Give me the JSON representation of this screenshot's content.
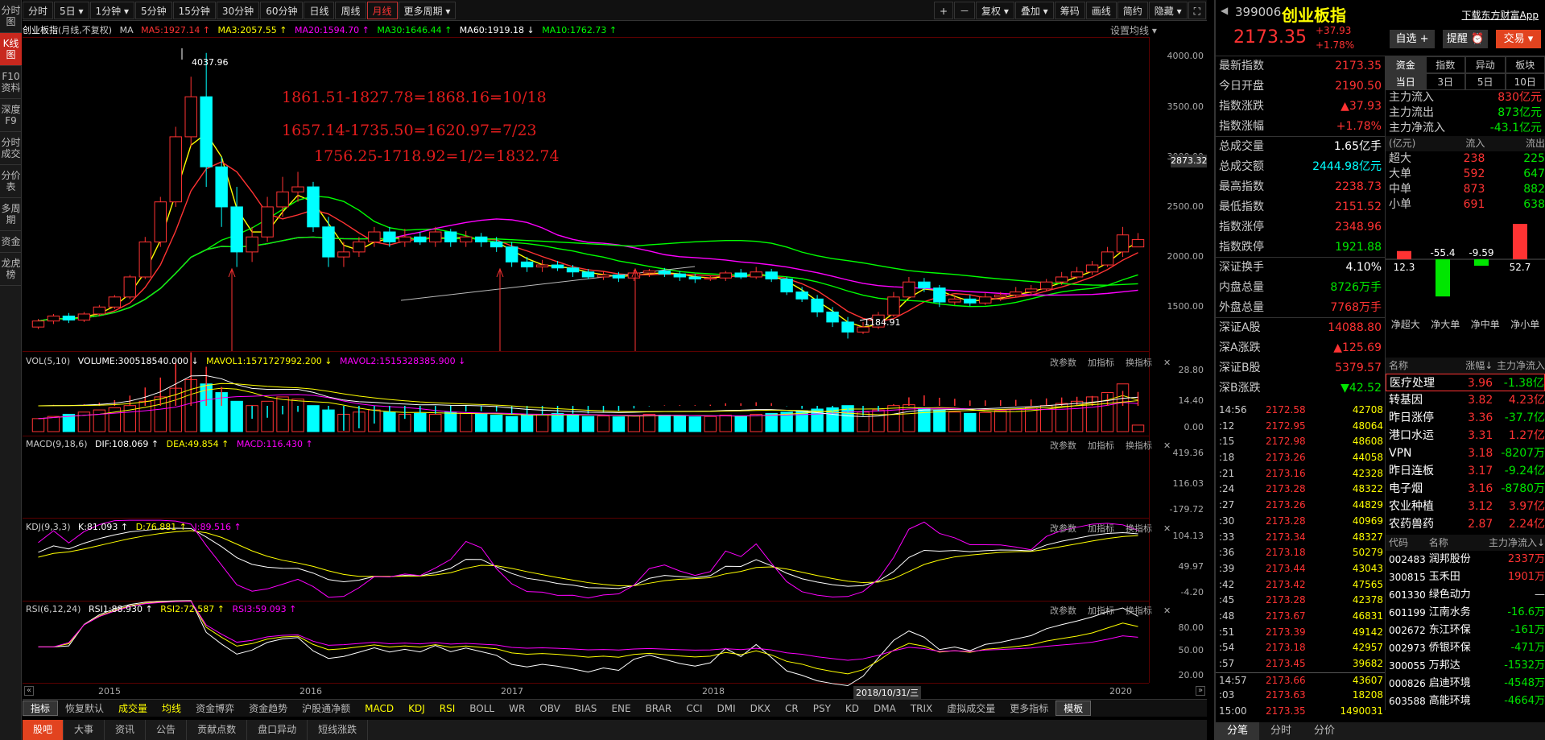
{
  "left_sidebar": [
    "分时图",
    "K线图",
    "F10资料",
    "深度F9",
    "分时成交",
    "分价表",
    "多周期",
    "资金",
    "龙虎榜"
  ],
  "toolbar": {
    "periods": [
      "分时",
      "5日 ▾",
      "1分钟 ▾",
      "5分钟",
      "15分钟",
      "30分钟",
      "60分钟",
      "日线",
      "周线",
      "月线",
      "更多周期 ▾"
    ],
    "active_period": "月线",
    "right": [
      "+",
      "－",
      "复权 ▾",
      "叠加 ▾",
      "筹码",
      "画线",
      "简约",
      "隐藏 ▾",
      "⛶"
    ]
  },
  "info_bar": {
    "name": "创业板指",
    "mode": "(月线,不复权)",
    "ma": "MA",
    "ma5": "MA5:1927.14 ↑",
    "ma3": "MA3:2057.55 ↑",
    "ma20": "MA20:1594.70 ↑",
    "ma30": "MA30:1646.44 ↑",
    "ma60": "MA60:1919.18 ↓",
    "ma10": "MA10:1762.73 ↑",
    "settings": "设置均线 ▾"
  },
  "annotations": [
    "1861.51-1827.78=1868.16=10/18",
    "1657.14-1735.50=1620.97=7/23",
    "1756.25-1718.92=1/2=1832.74"
  ],
  "main_axis": [
    "4000.00",
    "3500.00",
    "3000.00",
    "2500.00",
    "2000.00",
    "1500.00"
  ],
  "price_tag": "2873.32",
  "peak_label": "4037.96",
  "low_label": "1184.91",
  "vol": {
    "title": "VOL(5,10)",
    "volume": "VOLUME:300518540.000 ↓",
    "mavol1": "MAVOL1:1571727992.200 ↓",
    "mavol2": "MAVOL2:1515328385.900 ↓",
    "axis": [
      "28.80",
      "14.40",
      "0.00"
    ]
  },
  "macd": {
    "title": "MACD(9,18,6)",
    "dif": "DIF:108.069 ↑",
    "dea": "DEA:49.854 ↑",
    "macd": "MACD:116.430 ↑",
    "axis": [
      "419.36",
      "116.03",
      "-179.72"
    ]
  },
  "kdj": {
    "title": "KDJ(9,3,3)",
    "k": "K:81.093 ↑",
    "d": "D:76.881 ↑",
    "j": "J:89.516 ↑",
    "axis": [
      "104.13",
      "49.97",
      "-4.20"
    ]
  },
  "rsi": {
    "title": "RSI(6,12,24)",
    "r1": "RSI1:88.930 ↑",
    "r2": "RSI2:72.587 ↑",
    "r3": "RSI3:59.093 ↑",
    "axis": [
      "80.00",
      "50.00",
      "20.00"
    ]
  },
  "pane_buttons": [
    "改参数",
    "加指标",
    "换指标",
    "✕"
  ],
  "x_axis": [
    "2015",
    "2016",
    "2017",
    "2018",
    "2020"
  ],
  "x_cursor": "2018/10/31/三",
  "indicator_tabs": [
    "指标",
    "恢复默认",
    "成交量",
    "均线",
    "资金博弈",
    "资金趋势",
    "沪股通净额",
    "MACD",
    "KDJ",
    "RSI",
    "BOLL",
    "WR",
    "OBV",
    "BIAS",
    "ENE",
    "BRAR",
    "CCI",
    "DMI",
    "DKX",
    "CR",
    "PSY",
    "KD",
    "DMA",
    "TRIX",
    "虚拟成交量",
    "更多指标",
    "模板"
  ],
  "bottom_tabs": [
    "股吧",
    "大事",
    "资讯",
    "公告",
    "贡献点数",
    "盘口异动",
    "短线涨跌"
  ],
  "right_panel": {
    "code": "399006",
    "name": "创业板指",
    "download": "下载东方财富App",
    "price": "2173.35",
    "change": "+37.93",
    "pct": "+1.78%",
    "buttons": [
      "自选 +",
      "提醒 ⏰",
      "交易 ▾"
    ],
    "stats": [
      [
        "最新指数",
        "2173.35",
        "red"
      ],
      [
        "今日开盘",
        "2190.50",
        "red"
      ],
      [
        "指数涨跌",
        "▲37.93",
        "red"
      ],
      [
        "指数涨幅",
        "+1.78%",
        "red"
      ],
      [
        "总成交量",
        "1.65亿手",
        "wt"
      ],
      [
        "总成交额",
        "2444.98亿元",
        "cy"
      ],
      [
        "最高指数",
        "2238.73",
        "red"
      ],
      [
        "最低指数",
        "2151.52",
        "red"
      ],
      [
        "指数涨停",
        "2348.96",
        "red"
      ],
      [
        "指数跌停",
        "1921.88",
        "grn"
      ],
      [
        "深证换手",
        "4.10%",
        "wt"
      ],
      [
        "内盘总量",
        "8726万手",
        "grn"
      ],
      [
        "外盘总量",
        "7768万手",
        "red"
      ],
      [
        "深证A股",
        "14088.80",
        "red"
      ],
      [
        "深A涨跌",
        "▲125.69",
        "red"
      ],
      [
        "深证B股",
        "5379.57",
        "red"
      ],
      [
        "深B涨跌",
        "▼42.52",
        "grn"
      ]
    ],
    "fund_tabs1": [
      "资金",
      "指数",
      "异动",
      "板块"
    ],
    "fund_tabs2": [
      "当日",
      "3日",
      "5日",
      "10日"
    ],
    "flow": [
      [
        "主力流入",
        "830亿元",
        "red"
      ],
      [
        "主力流出",
        "873亿元",
        "grn"
      ],
      [
        "主力净流入",
        "-43.1亿元",
        "grn"
      ]
    ],
    "flow_hdr": [
      "(亿元)",
      "流入",
      "流出"
    ],
    "flow_rows": [
      [
        "超大",
        "238",
        "225"
      ],
      [
        "大单",
        "592",
        "647"
      ],
      [
        "中单",
        "873",
        "882"
      ],
      [
        "小单",
        "691",
        "638"
      ]
    ],
    "bars": [
      {
        "label": "12.3",
        "value": 12.3
      },
      {
        "label": "-55.4",
        "value": -55.4
      },
      {
        "label": "-9.59",
        "value": -9.59
      },
      {
        "label": "52.7",
        "value": 52.7
      }
    ],
    "bar_names": [
      "净超大",
      "净大单",
      "净中单",
      "净小单"
    ],
    "sector_hdr": [
      "名称",
      "涨幅↓",
      "主力净流入"
    ],
    "sectors": [
      [
        "医疗处理",
        "3.96",
        "-1.38亿"
      ],
      [
        "转基因",
        "3.82",
        "4.23亿"
      ],
      [
        "昨日涨停",
        "3.36",
        "-37.7亿"
      ],
      [
        "港口水运",
        "3.31",
        "1.27亿"
      ],
      [
        "VPN",
        "3.18",
        "-8207万"
      ],
      [
        "昨日连板",
        "3.17",
        "-9.24亿"
      ],
      [
        "电子烟",
        "3.16",
        "-8780万"
      ],
      [
        "农业种植",
        "3.12",
        "3.97亿"
      ],
      [
        "农药兽药",
        "2.87",
        "2.24亿"
      ]
    ],
    "stock_hdr": [
      "代码",
      "名称",
      "主力净流入↓"
    ],
    "stocks": [
      [
        "002483",
        "润邦股份",
        "2337万"
      ],
      [
        "300815",
        "玉禾田",
        "1901万"
      ],
      [
        "601330",
        "绿色动力",
        "—"
      ],
      [
        "601199",
        "江南水务",
        "-16.6万"
      ],
      [
        "002672",
        "东江环保",
        "-161万"
      ],
      [
        "002973",
        "侨银环保",
        "-471万"
      ],
      [
        "300055",
        "万邦达",
        "-1532万"
      ],
      [
        "000826",
        "启迪环境",
        "-4548万"
      ],
      [
        "603588",
        "高能环境",
        "-4664万"
      ]
    ],
    "ticks": [
      [
        "14:56",
        "2172.58",
        "42708"
      ],
      [
        ":12",
        "2172.95",
        "48064"
      ],
      [
        ":15",
        "2172.98",
        "48608"
      ],
      [
        ":18",
        "2173.26",
        "44058"
      ],
      [
        ":21",
        "2173.16",
        "42328"
      ],
      [
        ":24",
        "2173.28",
        "48322"
      ],
      [
        ":27",
        "2173.26",
        "44829"
      ],
      [
        ":30",
        "2173.28",
        "40969"
      ],
      [
        ":33",
        "2173.34",
        "48327"
      ],
      [
        ":36",
        "2173.18",
        "50279"
      ],
      [
        ":39",
        "2173.44",
        "43043"
      ],
      [
        ":42",
        "2173.42",
        "47565"
      ],
      [
        ":45",
        "2173.28",
        "42378"
      ],
      [
        ":48",
        "2173.67",
        "46831"
      ],
      [
        ":51",
        "2173.39",
        "49142"
      ],
      [
        ":54",
        "2173.18",
        "42957"
      ],
      [
        ":57",
        "2173.45",
        "39682"
      ],
      [
        "14:57",
        "2173.66",
        "43607"
      ],
      [
        ":03",
        "2173.63",
        "18208"
      ],
      [
        "15:00",
        "2173.35",
        "1490031"
      ]
    ],
    "foot_tabs": [
      "分笔",
      "分时",
      "分价"
    ]
  },
  "colors": {
    "up": "#ff3333",
    "down": "#00ffff",
    "ma5": "#ffffff",
    "ma10": "#ffff00",
    "ma20": "#ff00ff",
    "ma30": "#00ff00",
    "ma60": "#ff3333",
    "accent": "#e2431f"
  },
  "chart_data": {
    "type": "candlestick",
    "title": "创业板指 (月线,不复权)",
    "ylim": [
      1100,
      4100
    ],
    "candles": [
      [
        1300,
        1360,
        1280,
        1380
      ],
      [
        1360,
        1410,
        1330,
        1430
      ],
      [
        1410,
        1370,
        1340,
        1440
      ],
      [
        1370,
        1430,
        1350,
        1450
      ],
      [
        1430,
        1500,
        1410,
        1520
      ],
      [
        1500,
        1600,
        1480,
        1620
      ],
      [
        1600,
        1800,
        1580,
        1820
      ],
      [
        1800,
        2150,
        1780,
        2200
      ],
      [
        2150,
        2550,
        2100,
        2600
      ],
      [
        2550,
        3200,
        2500,
        3300
      ],
      [
        3200,
        3600,
        3100,
        3800
      ],
      [
        3600,
        2900,
        2700,
        4037.96
      ],
      [
        2900,
        2500,
        2300,
        3000
      ],
      [
        2500,
        2050,
        1900,
        2700
      ],
      [
        2050,
        2200,
        1950,
        2300
      ],
      [
        2200,
        2500,
        2150,
        2600
      ],
      [
        2500,
        2650,
        2400,
        2800
      ],
      [
        2650,
        2700,
        2550,
        2850
      ],
      [
        2700,
        2300,
        2250,
        2750
      ],
      [
        2300,
        2000,
        1900,
        2400
      ],
      [
        2000,
        2050,
        1900,
        2150
      ],
      [
        2050,
        2150,
        2000,
        2200
      ],
      [
        2150,
        2250,
        2100,
        2300
      ],
      [
        2250,
        2150,
        2100,
        2300
      ],
      [
        2150,
        2200,
        2100,
        2280
      ],
      [
        2200,
        2150,
        2120,
        2250
      ],
      [
        2150,
        2250,
        2100,
        2300
      ],
      [
        2250,
        2150,
        2100,
        2280
      ],
      [
        2150,
        2200,
        2100,
        2260
      ],
      [
        2200,
        2150,
        2100,
        2240
      ],
      [
        2150,
        2100,
        2050,
        2200
      ],
      [
        2100,
        1950,
        1900,
        2150
      ],
      [
        1950,
        1900,
        1850,
        2000
      ],
      [
        1900,
        1920,
        1850,
        1970
      ],
      [
        1920,
        1890,
        1860,
        1960
      ],
      [
        1890,
        1850,
        1800,
        1920
      ],
      [
        1850,
        1800,
        1780,
        1880
      ],
      [
        1800,
        1820,
        1770,
        1860
      ],
      [
        1820,
        1790,
        1750,
        1850
      ],
      [
        1790,
        1840,
        1760,
        1870
      ],
      [
        1840,
        1860,
        1800,
        1880
      ],
      [
        1860,
        1830,
        1800,
        1890
      ],
      [
        1830,
        1800,
        1760,
        1860
      ],
      [
        1800,
        1780,
        1740,
        1830
      ],
      [
        1780,
        1790,
        1760,
        1810
      ],
      [
        1790,
        1840,
        1760,
        1860
      ],
      [
        1840,
        1800,
        1780,
        1880
      ],
      [
        1800,
        1850,
        1780,
        1900
      ],
      [
        1850,
        1780,
        1750,
        1880
      ],
      [
        1780,
        1650,
        1620,
        1800
      ],
      [
        1650,
        1580,
        1550,
        1700
      ],
      [
        1580,
        1450,
        1400,
        1620
      ],
      [
        1450,
        1350,
        1300,
        1500
      ],
      [
        1350,
        1250,
        1184.91,
        1400
      ],
      [
        1250,
        1300,
        1230,
        1350
      ],
      [
        1300,
        1420,
        1280,
        1450
      ],
      [
        1420,
        1600,
        1400,
        1650
      ],
      [
        1600,
        1750,
        1580,
        1800
      ],
      [
        1750,
        1690,
        1650,
        1790
      ],
      [
        1690,
        1550,
        1500,
        1720
      ],
      [
        1550,
        1580,
        1520,
        1620
      ],
      [
        1580,
        1540,
        1510,
        1620
      ],
      [
        1540,
        1600,
        1520,
        1640
      ],
      [
        1600,
        1620,
        1560,
        1650
      ],
      [
        1620,
        1650,
        1600,
        1700
      ],
      [
        1650,
        1680,
        1620,
        1720
      ],
      [
        1680,
        1750,
        1660,
        1780
      ],
      [
        1750,
        1800,
        1720,
        1850
      ],
      [
        1800,
        1850,
        1780,
        1900
      ],
      [
        1850,
        1920,
        1820,
        1960
      ],
      [
        1920,
        2050,
        1900,
        2100
      ],
      [
        2050,
        2220,
        2000,
        2300
      ],
      [
        2100,
        2173.35,
        2100,
        2238.73
      ]
    ],
    "x_labels": [
      "2015",
      "2016",
      "2017",
      "2018",
      "2020"
    ]
  }
}
